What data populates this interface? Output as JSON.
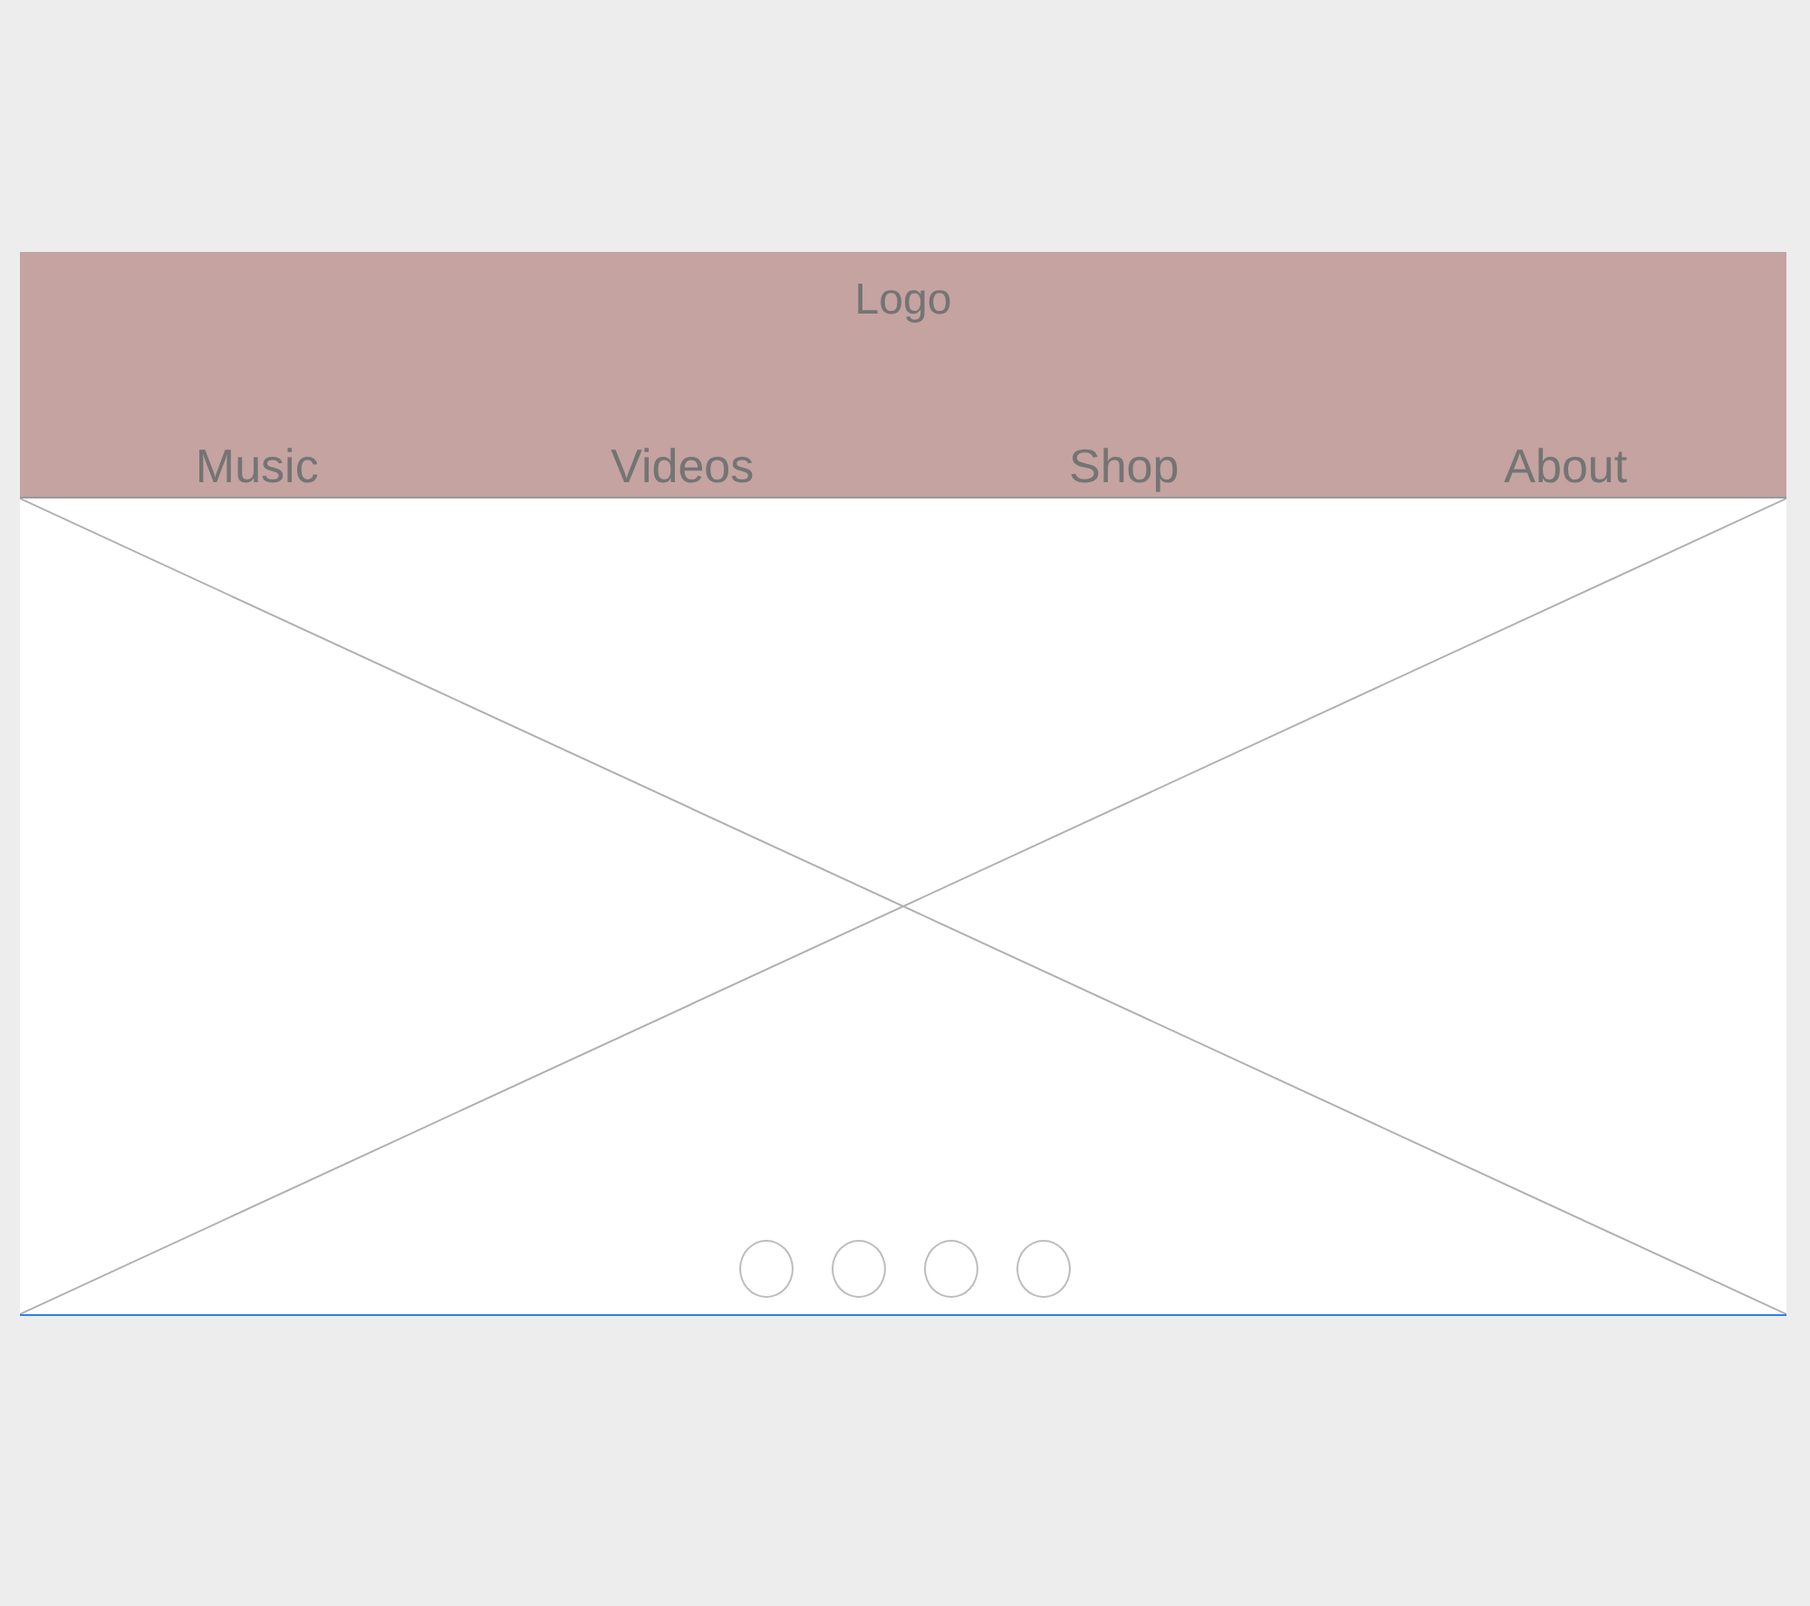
{
  "header": {
    "logo": "Logo",
    "nav": [
      {
        "label": "Music"
      },
      {
        "label": "Videos"
      },
      {
        "label": "Shop"
      },
      {
        "label": "About"
      }
    ]
  },
  "carousel": {
    "dots": [
      {
        "selected": false
      },
      {
        "selected": false
      },
      {
        "selected": false
      },
      {
        "selected": false
      }
    ]
  }
}
